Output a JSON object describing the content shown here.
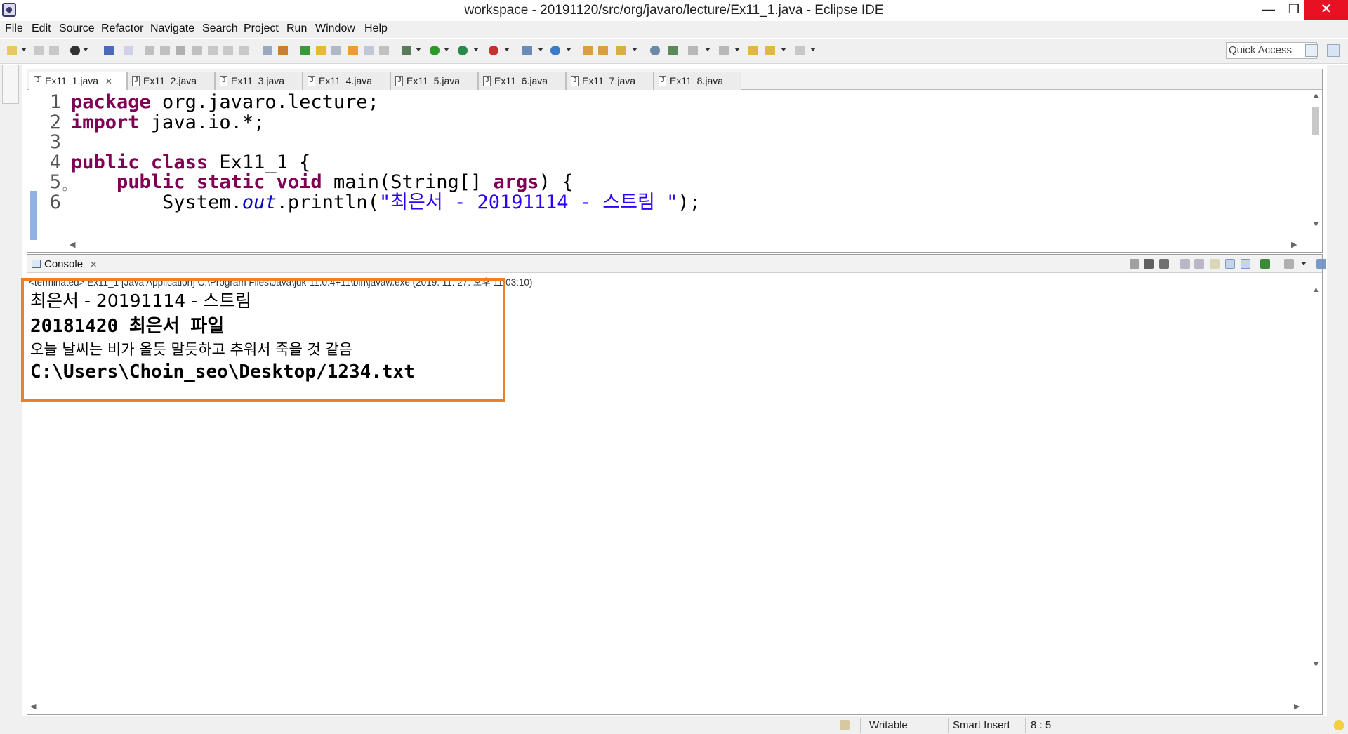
{
  "window": {
    "title": "workspace - 20191120/src/org/javaro/lecture/Ex11_1.java - Eclipse IDE",
    "minimize_glyph": "—",
    "maximize_glyph": "❐",
    "close_glyph": "✕"
  },
  "menu": [
    "File",
    "Edit",
    "Source",
    "Refactor",
    "Navigate",
    "Search",
    "Project",
    "Run",
    "Window",
    "Help"
  ],
  "toolbar": {
    "quick_access": "Quick Access"
  },
  "editor": {
    "tabs": [
      {
        "label": "Ex11_1.java",
        "active": true,
        "close": "✕"
      },
      {
        "label": "Ex11_2.java",
        "active": false
      },
      {
        "label": "Ex11_3.java",
        "active": false
      },
      {
        "label": "Ex11_4.java",
        "active": false
      },
      {
        "label": "Ex11_5.java",
        "active": false
      },
      {
        "label": "Ex11_6.java",
        "active": false
      },
      {
        "label": "Ex11_7.java",
        "active": false
      },
      {
        "label": "Ex11_8.java",
        "active": false
      }
    ],
    "lines": [
      {
        "num": "1",
        "parts": [
          {
            "t": "package",
            "c": "kw"
          },
          {
            "t": " org.javaro.lecture;",
            "c": "plain"
          }
        ]
      },
      {
        "num": "2",
        "parts": [
          {
            "t": "import",
            "c": "kw"
          },
          {
            "t": " java.io.*;",
            "c": "plain"
          }
        ]
      },
      {
        "num": "3",
        "parts": []
      },
      {
        "num": "4",
        "parts": [
          {
            "t": "public",
            "c": "kw"
          },
          {
            "t": " ",
            "c": "plain"
          },
          {
            "t": "class",
            "c": "kw"
          },
          {
            "t": " Ex11_1 {",
            "c": "plain"
          }
        ]
      },
      {
        "num": "5",
        "fold": "⊖",
        "parts": [
          {
            "t": "    ",
            "c": "plain"
          },
          {
            "t": "public",
            "c": "kw"
          },
          {
            "t": " ",
            "c": "plain"
          },
          {
            "t": "static",
            "c": "kw"
          },
          {
            "t": " ",
            "c": "plain"
          },
          {
            "t": "void",
            "c": "kw"
          },
          {
            "t": " main(String[] ",
            "c": "plain"
          },
          {
            "t": "args",
            "c": "kw"
          },
          {
            "t": ") {",
            "c": "plain"
          }
        ]
      },
      {
        "num": "6",
        "parts": [
          {
            "t": "        System.",
            "c": "plain"
          },
          {
            "t": "out",
            "c": "fld"
          },
          {
            "t": ".println(",
            "c": "plain"
          },
          {
            "t": "\"최은서 - 20191114 - 스트림 \"",
            "c": "str"
          },
          {
            "t": ");",
            "c": "plain"
          }
        ]
      }
    ]
  },
  "console": {
    "tab_label": "Console",
    "tab_close": "✕",
    "status_line": "<terminated> Ex11_1 [Java Application] C:\\Program Files\\Java\\jdk-11.0.4+11\\bin\\javaw.exe (2019. 11. 27. 오후 11:03:10)",
    "output": [
      "최은서 - 20191114 - 스트림",
      "20181420 최은서 파일",
      "오늘 날씨는 비가 올듯 말듯하고 추워서 죽을 것 같음",
      "C:\\Users\\Choin_seo\\Desktop/1234.txt"
    ]
  },
  "statusbar": {
    "writable": "Writable",
    "insert_mode": "Smart Insert",
    "position": "8 : 5"
  },
  "colors": {
    "keyword": "#7f0055",
    "string": "#2a00ff",
    "field": "#0000c0",
    "highlight_box": "#f07f24",
    "close_button": "#e81123"
  }
}
